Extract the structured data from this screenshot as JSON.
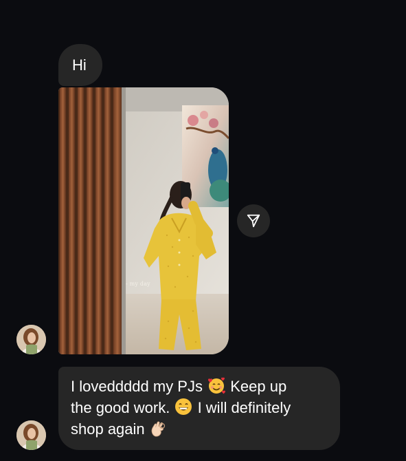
{
  "messages": {
    "first_text": "Hi",
    "photo_caption": "- my day",
    "line_1_a": "I loveddddd my PJs",
    "line_1_b": "Keep up",
    "line_2_a": "the good work.",
    "line_2_b": "I will definitely",
    "line_3_a": "shop again"
  },
  "icons": {
    "share": "send-paper-plane-icon",
    "emoji_1": "smiling-face-with-hearts-emoji",
    "emoji_2": "grinning-face-emoji",
    "emoji_3": "ok-hand-emoji"
  },
  "colors": {
    "background": "#0b0c10",
    "bubble": "#262626",
    "text": "#ffffff",
    "pajama": "#e7c33a"
  }
}
